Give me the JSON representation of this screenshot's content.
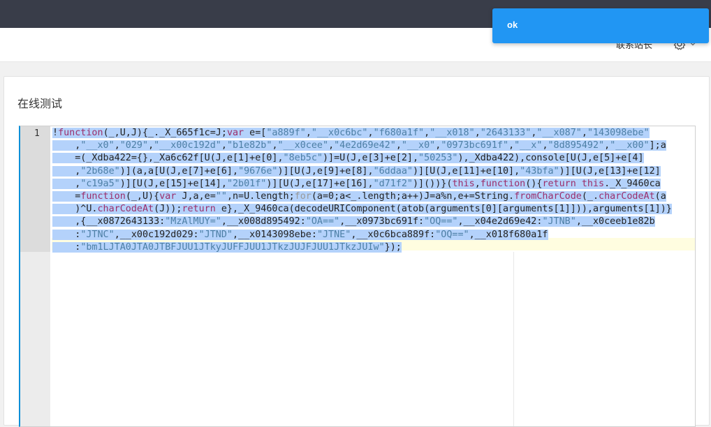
{
  "toast": {
    "message": "ok"
  },
  "nav": {
    "contact_label": "联系站长",
    "gear_icon": "gear-icon",
    "chevron_icon": "chevron-down-icon"
  },
  "card": {
    "title": "在线测试"
  },
  "editor": {
    "line_number": "1",
    "lines": [
      "!function(_,U,J){_._X_665f1c=J;var e=[\"a889f\",\"__x0c6bc\",\"f680a1f\",\"__x018\",\"2643133\",\"__x087\",\"143098ebe\"",
      "    ,\"__x0\",\"029\",\"__x00c192d\",\"b1e82b\",\"__x0cee\",\"4e2d69e42\",\"__x0\",\"0973bc691f\",\"__x\",\"8d895492\",\"__x00\"];a",
      "    =(_Xdba422={},_Xa6c62f[U(J,e[1]+e[0],\"8eb5c\")]=U(J,e[3]+e[2],\"50253\"),_Xdba422),console[U(J,e[5]+e[4]",
      "    ,\"2b68e\")](a,a[U(J,e[7]+e[6],\"9676e\")][U(J,e[9]+e[8],\"6ddaa\")][U(J,e[11]+e[10],\"43bfa\")][U(J,e[13]+e[12]",
      "    ,\"c19a5\")][U(J,e[15]+e[14],\"2b01f\")][U(J,e[17]+e[16],\"d71f2\")]())}(this,function(){return this._X_9460ca",
      "    =function(_,U){var J,a,e=\"\",n=U.length;for(a=0;a<_.length;a++)J=a%n,e+=String.fromCharCode(_.charCodeAt(a",
      "    )^U.charCodeAt(J));return e},_X_9460ca(decodeURIComponent(atob(arguments[0][arguments[1]])),arguments[1])}",
      "    ,{__x0872643133:\"MzAlMUY=\",__x008d895492:\"OA==\",__x0973bc691f:\"OQ==\",__x04e2d69e42:\"JTNB\",__x0ceeb1e82b",
      "    :\"JTNC\",__x00c192d029:\"JTND\",__x0143098ebe:\"JTNE\",__x0c6bca889f:\"OQ==\",__x018f680a1f",
      "    :\"bm1LJTA0JTA0JTBFJUU1JTkyJUFFJUU1JTkzJUJFJUU1JTkzJUIw\"});"
    ]
  }
}
